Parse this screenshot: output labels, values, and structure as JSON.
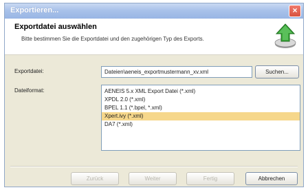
{
  "window": {
    "title": "Exportieren...",
    "close_glyph": "×"
  },
  "header": {
    "title": "Exportdatei auswählen",
    "description": "Bitte bestimmen Sie die Exportdatei und den zugehörigen Typ des Exports.",
    "icon": "export-arrow-icon",
    "accent_color": "#3aa63a"
  },
  "file": {
    "label": "Exportdatei:",
    "value": "Dateien\\aeneis_exportmustermann_xv.xml",
    "browse_label": "Suchen..."
  },
  "format": {
    "label": "Dateiformat:",
    "options": [
      "AENEIS 5.x XML Export Datei (*.xml)",
      "XPDL 2.0 (*.xml)",
      "BPEL 1.1 (*.bpel, *.xml)",
      "Xpert.ivy (*.xml)",
      "DA7 (*.xml)"
    ],
    "selected_index": 3
  },
  "buttons": {
    "back": "Zurück",
    "next": "Weiter",
    "finish": "Fertig",
    "cancel": "Abbrechen"
  }
}
